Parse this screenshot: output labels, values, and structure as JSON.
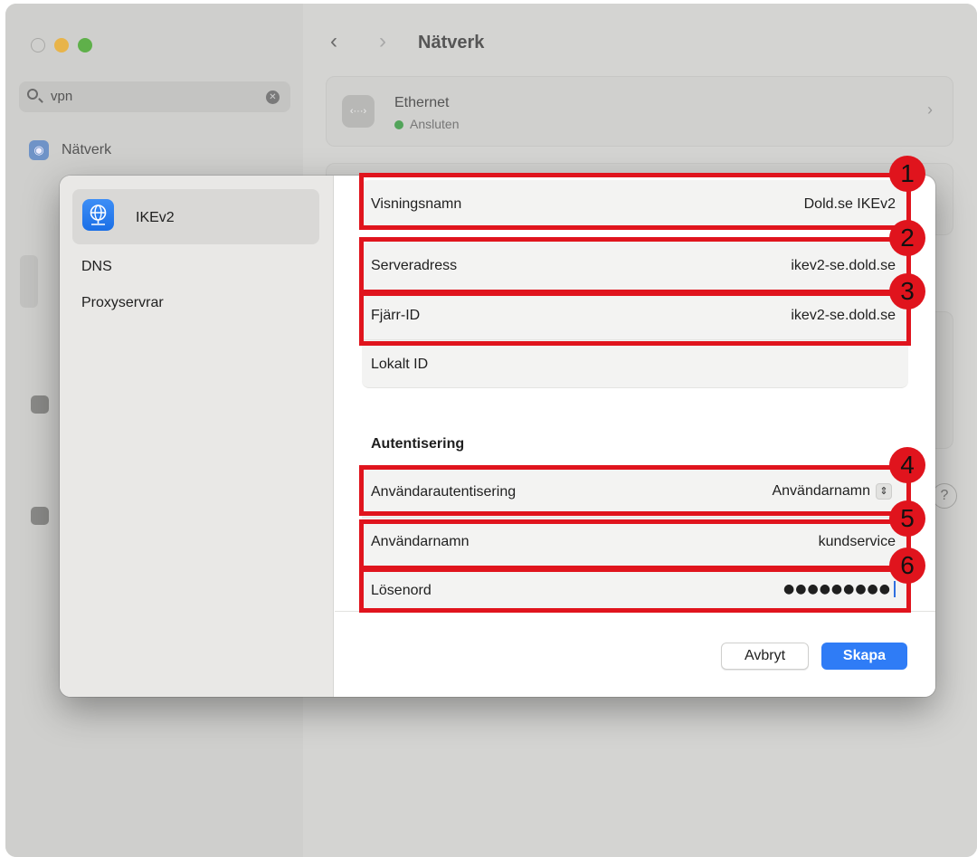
{
  "background": {
    "search": {
      "value": "vpn"
    },
    "sidebar_item": "Nätverk",
    "header": {
      "back": "‹",
      "forward": "›",
      "title": "Nätverk"
    },
    "ethernet": {
      "name": "Ethernet",
      "status": "Ansluten",
      "status_color": "#52a45a",
      "icon": "ethernet-icon"
    },
    "help": "?"
  },
  "dialog": {
    "sidebar": {
      "items": [
        {
          "label": "IKEv2",
          "selected": true,
          "icon": "globe-network-icon"
        },
        {
          "label": "DNS"
        },
        {
          "label": "Proxyservrar"
        }
      ]
    },
    "fields": {
      "display_name": {
        "label": "Visningsnamn",
        "value": "Dold.se IKEv2"
      },
      "server_address": {
        "label": "Serveradress",
        "value": "ikev2-se.dold.se"
      },
      "remote_id": {
        "label": "Fjärr-ID",
        "value": "ikev2-se.dold.se"
      },
      "local_id": {
        "label": "Lokalt ID",
        "value": ""
      }
    },
    "auth": {
      "section_title": "Autentisering",
      "user_auth": {
        "label": "Användarautentisering",
        "value": "Användarnamn"
      },
      "username": {
        "label": "Användarnamn",
        "value": "kundservice"
      },
      "password": {
        "label": "Lösenord",
        "value": "●●●●●●●●●"
      }
    },
    "buttons": {
      "cancel": "Avbryt",
      "create": "Skapa"
    },
    "accent_color": "#2f7cf6"
  },
  "annotations": [
    {
      "number": "1"
    },
    {
      "number": "2"
    },
    {
      "number": "3"
    },
    {
      "number": "4"
    },
    {
      "number": "5"
    },
    {
      "number": "6"
    }
  ],
  "annotation_color": "#e0141d"
}
